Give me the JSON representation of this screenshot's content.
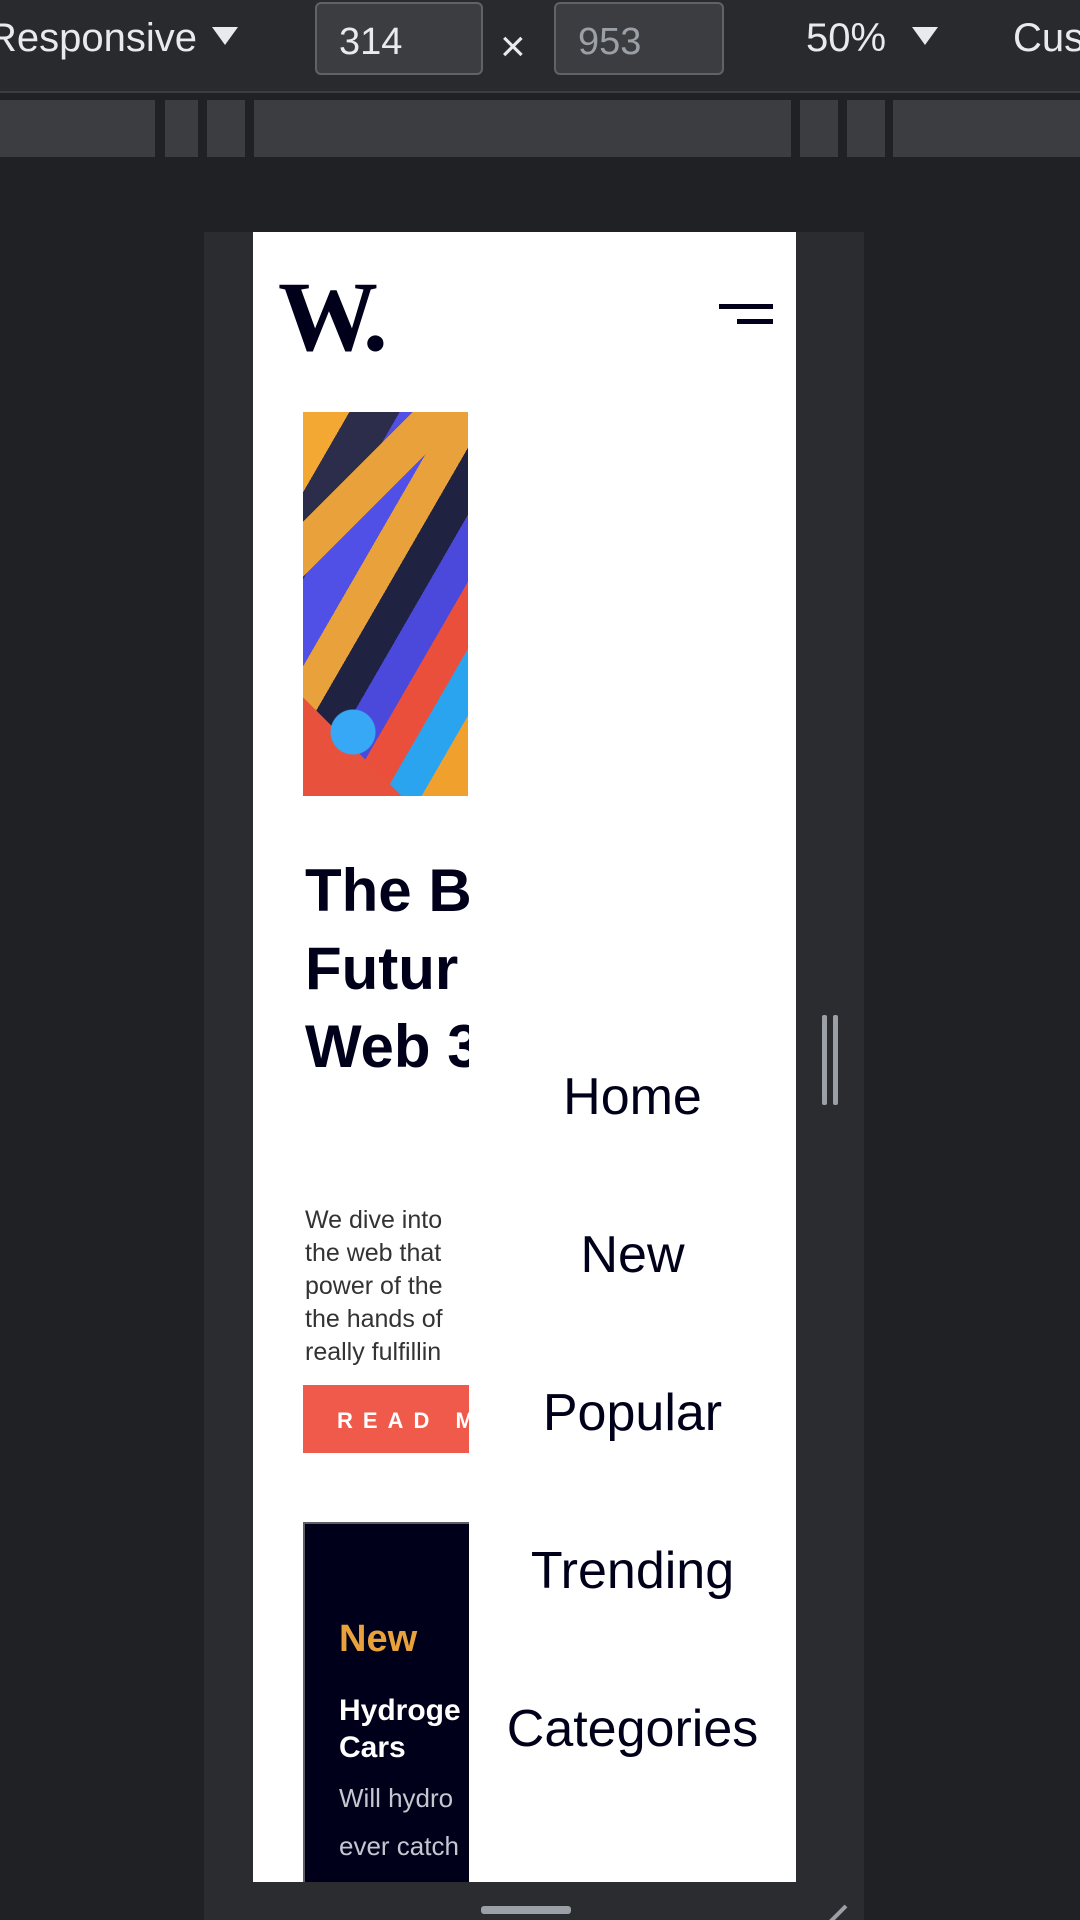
{
  "toolbar": {
    "device_mode": "Responsive",
    "width_value": "314",
    "height_placeholder": "953",
    "times": "×",
    "zoom": "50%",
    "custom_label": "Cus"
  },
  "site": {
    "logo": "W.",
    "hero": {
      "title_line1": "The B",
      "title_line2": "Futur",
      "title_line3": "Web 3",
      "text_lines": [
        "We dive into",
        "the web that",
        "power of the",
        "the hands of",
        "really fulfillin"
      ],
      "button": "READ M"
    },
    "new_section": {
      "title": "New",
      "item_title_line1": "Hydroge",
      "item_title_line2": "Cars",
      "item_text_line1": "Will hydro",
      "item_text_line2": "ever catch"
    },
    "menu": [
      "Home",
      "New",
      "Popular",
      "Trending",
      "Categories"
    ]
  },
  "colors": {
    "accent": "#f05a4a",
    "new_title": "#e9a23b",
    "dark": "#00001a"
  }
}
